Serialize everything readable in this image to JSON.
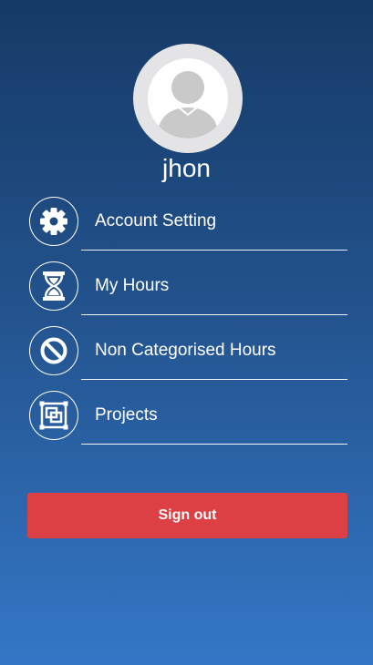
{
  "profile": {
    "username": "jhon",
    "avatar_icon": "user-placeholder-icon"
  },
  "menu": {
    "items": [
      {
        "label": "Account Setting",
        "icon": "gear-icon"
      },
      {
        "label": "My Hours",
        "icon": "hourglass-icon"
      },
      {
        "label": "Non Categorised Hours",
        "icon": "prohibited-icon"
      },
      {
        "label": "Projects",
        "icon": "projects-icon"
      }
    ]
  },
  "actions": {
    "sign_out_label": "Sign out"
  },
  "colors": {
    "background_top": "#163a66",
    "background_bottom": "#3477c6",
    "sign_out_button": "#dc4044",
    "avatar_ring": "#e4e4e6"
  }
}
